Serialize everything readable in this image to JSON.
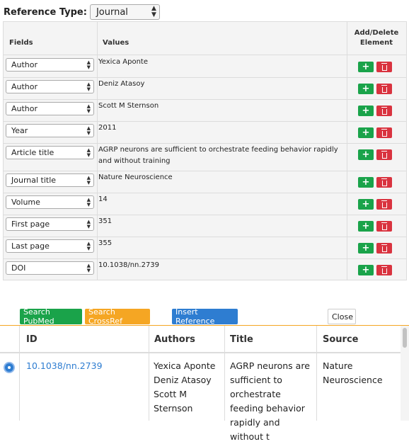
{
  "reference_type": {
    "label": "Reference Type:",
    "selected": "Journal"
  },
  "fields_table": {
    "headers": {
      "fields": "Fields",
      "values": "Values",
      "add_delete": "Add/Delete Element"
    },
    "rows": [
      {
        "field": "Author",
        "value": "Yexica Aponte"
      },
      {
        "field": "Author",
        "value": "Deniz Atasoy"
      },
      {
        "field": "Author",
        "value": "Scott M Sternson"
      },
      {
        "field": "Year",
        "value": "2011"
      },
      {
        "field": "Article title",
        "value": "AGRP neurons are sufficient to orchestrate feeding behavior rapidly and without training"
      },
      {
        "field": "Journal title",
        "value": "Nature Neuroscience"
      },
      {
        "field": "Volume",
        "value": "14"
      },
      {
        "field": "First page",
        "value": "351"
      },
      {
        "field": "Last page",
        "value": "355"
      },
      {
        "field": "DOI",
        "value": "10.1038/nn.2739"
      }
    ]
  },
  "actions": {
    "search_pubmed": "Search PubMed",
    "search_crossref": "Search CrossRef",
    "insert_reference": "Insert Reference",
    "close": "Close"
  },
  "results": {
    "headers": {
      "id": "ID",
      "authors": "Authors",
      "title": "Title",
      "source": "Source"
    },
    "rows": [
      {
        "selected": true,
        "id": "10.1038/nn.2739",
        "authors": "Yexica Aponte Deniz Atasoy Scott M Sternson",
        "title": "AGRP neurons are sufficient to orchestrate feeding behavior rapidly and without t",
        "source": "Nature Neuroscience"
      }
    ]
  },
  "colors": {
    "add_button": "#1aa34a",
    "delete_button": "#d9333f",
    "search_pubmed": "#1aa34a",
    "search_crossref": "#f5a623",
    "insert_reference": "#2e7dd1",
    "link": "#2e7dd1"
  },
  "icons": {
    "add": "plus-icon",
    "delete": "trash-icon",
    "select_chevron": "chevron-updown-icon",
    "selected_row": "radio-selected-icon"
  }
}
